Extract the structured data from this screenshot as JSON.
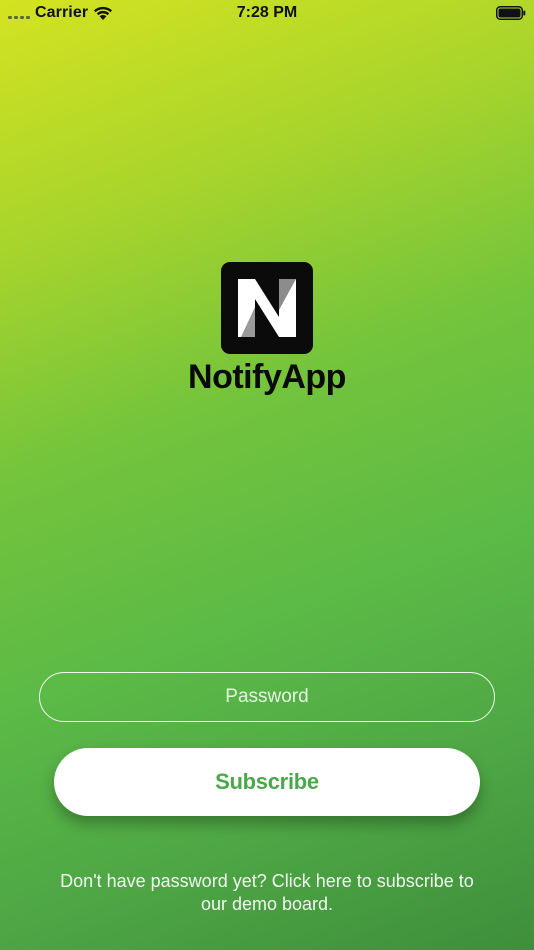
{
  "status_bar": {
    "carrier": "Carrier",
    "time": "7:28 PM",
    "wifi_icon": "wifi-icon",
    "battery_icon": "battery-icon"
  },
  "logo": {
    "icon": "notifyapp-logo-icon",
    "name": "NotifyApp"
  },
  "form": {
    "password_placeholder": "Password",
    "password_value": "",
    "subscribe_label": "Subscribe"
  },
  "footer": {
    "hint": "Don't have password yet? Click here to subscribe to our demo board."
  },
  "colors": {
    "gradient_top": "#d4e321",
    "gradient_bottom": "#3e8e3b",
    "button_text": "#4aa84b",
    "button_bg": "#ffffff"
  }
}
